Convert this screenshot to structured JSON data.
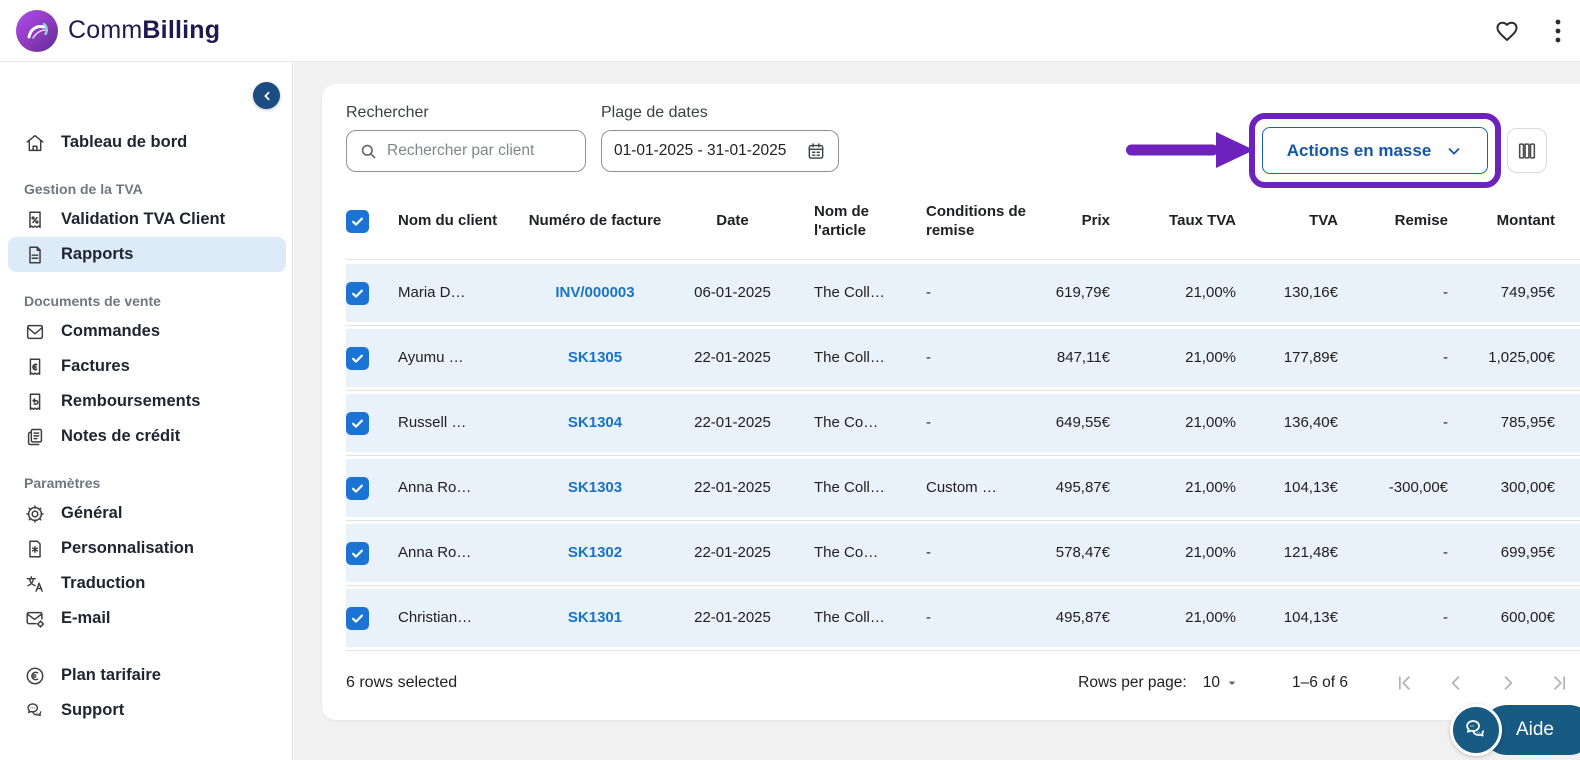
{
  "header": {
    "brand_prefix": "Comm",
    "brand_suffix": "Billing"
  },
  "sidebar": {
    "items": [
      {
        "label": "Tableau de bord",
        "icon": "home"
      },
      {
        "label": "Gestion de la TVA",
        "type": "section"
      },
      {
        "label": "Validation TVA Client",
        "icon": "receipt-percent"
      },
      {
        "label": "Rapports",
        "icon": "report-document",
        "selected": true
      },
      {
        "label": "Documents de vente",
        "type": "section"
      },
      {
        "label": "Commandes",
        "icon": "envelope"
      },
      {
        "label": "Factures",
        "icon": "receipt-euro"
      },
      {
        "label": "Remboursements",
        "icon": "receipt-refund"
      },
      {
        "label": "Notes de crédit",
        "icon": "credit-notes"
      },
      {
        "label": "Paramètres",
        "type": "section"
      },
      {
        "label": "Général",
        "icon": "gear"
      },
      {
        "label": "Personnalisation",
        "icon": "doc-star"
      },
      {
        "label": "Traduction",
        "icon": "translate"
      },
      {
        "label": "E-mail",
        "icon": "mail-gear"
      },
      {
        "label": "Plan tarifaire",
        "icon": "euro-circle"
      },
      {
        "label": "Support",
        "icon": "chat-bubbles"
      }
    ]
  },
  "filters": {
    "search_label": "Rechercher",
    "search_placeholder": "Rechercher par client",
    "date_label": "Plage de dates",
    "date_value": "01-01-2025 - 31-01-2025",
    "bulk_actions_label": "Actions en masse"
  },
  "table": {
    "columns": [
      "Nom du client",
      "Numéro de facture",
      "Date",
      "Nom de l'article",
      "Conditions de remise",
      "Prix",
      "Taux TVA",
      "TVA",
      "Remise",
      "Montant"
    ],
    "rows": [
      {
        "client": "Maria D…",
        "invoice": "INV/000003",
        "date": "06-01-2025",
        "article": "The Coll…",
        "terms": "-",
        "price": "619,79€",
        "vat_rate": "21,00%",
        "vat": "130,16€",
        "discount": "-",
        "amount": "749,95€"
      },
      {
        "client": "Ayumu …",
        "invoice": "SK1305",
        "date": "22-01-2025",
        "article": "The Coll…",
        "terms": "-",
        "price": "847,11€",
        "vat_rate": "21,00%",
        "vat": "177,89€",
        "discount": "-",
        "amount": "1,025,00€"
      },
      {
        "client": "Russell …",
        "invoice": "SK1304",
        "date": "22-01-2025",
        "article": "The Co…",
        "terms": "-",
        "price": "649,55€",
        "vat_rate": "21,00%",
        "vat": "136,40€",
        "discount": "-",
        "amount": "785,95€"
      },
      {
        "client": "Anna Ro…",
        "invoice": "SK1303",
        "date": "22-01-2025",
        "article": "The Coll…",
        "terms": "Custom …",
        "price": "495,87€",
        "vat_rate": "21,00%",
        "vat": "104,13€",
        "discount": "-300,00€",
        "amount": "300,00€"
      },
      {
        "client": "Anna Ro…",
        "invoice": "SK1302",
        "date": "22-01-2025",
        "article": "The Co…",
        "terms": "-",
        "price": "578,47€",
        "vat_rate": "21,00%",
        "vat": "121,48€",
        "discount": "-",
        "amount": "699,95€"
      },
      {
        "client": "Christian…",
        "invoice": "SK1301",
        "date": "22-01-2025",
        "article": "The Coll…",
        "terms": "-",
        "price": "495,87€",
        "vat_rate": "21,00%",
        "vat": "104,13€",
        "discount": "-",
        "amount": "600,00€"
      }
    ]
  },
  "footer": {
    "selected_text": "6 rows selected",
    "rows_per_page_label": "Rows per page:",
    "rows_per_page_value": "10",
    "range_text": "1–6 of 6"
  },
  "help": {
    "label": "Aide"
  },
  "colors": {
    "annotation_purple": "#6e22bd",
    "button_blue": "#1565c0",
    "link_blue": "#1a73c7",
    "checkbox_blue": "#1b74d4",
    "row_blue": "#e9f1fa",
    "help_blue": "#175a82",
    "brand_navy": "#1e1a4f"
  }
}
